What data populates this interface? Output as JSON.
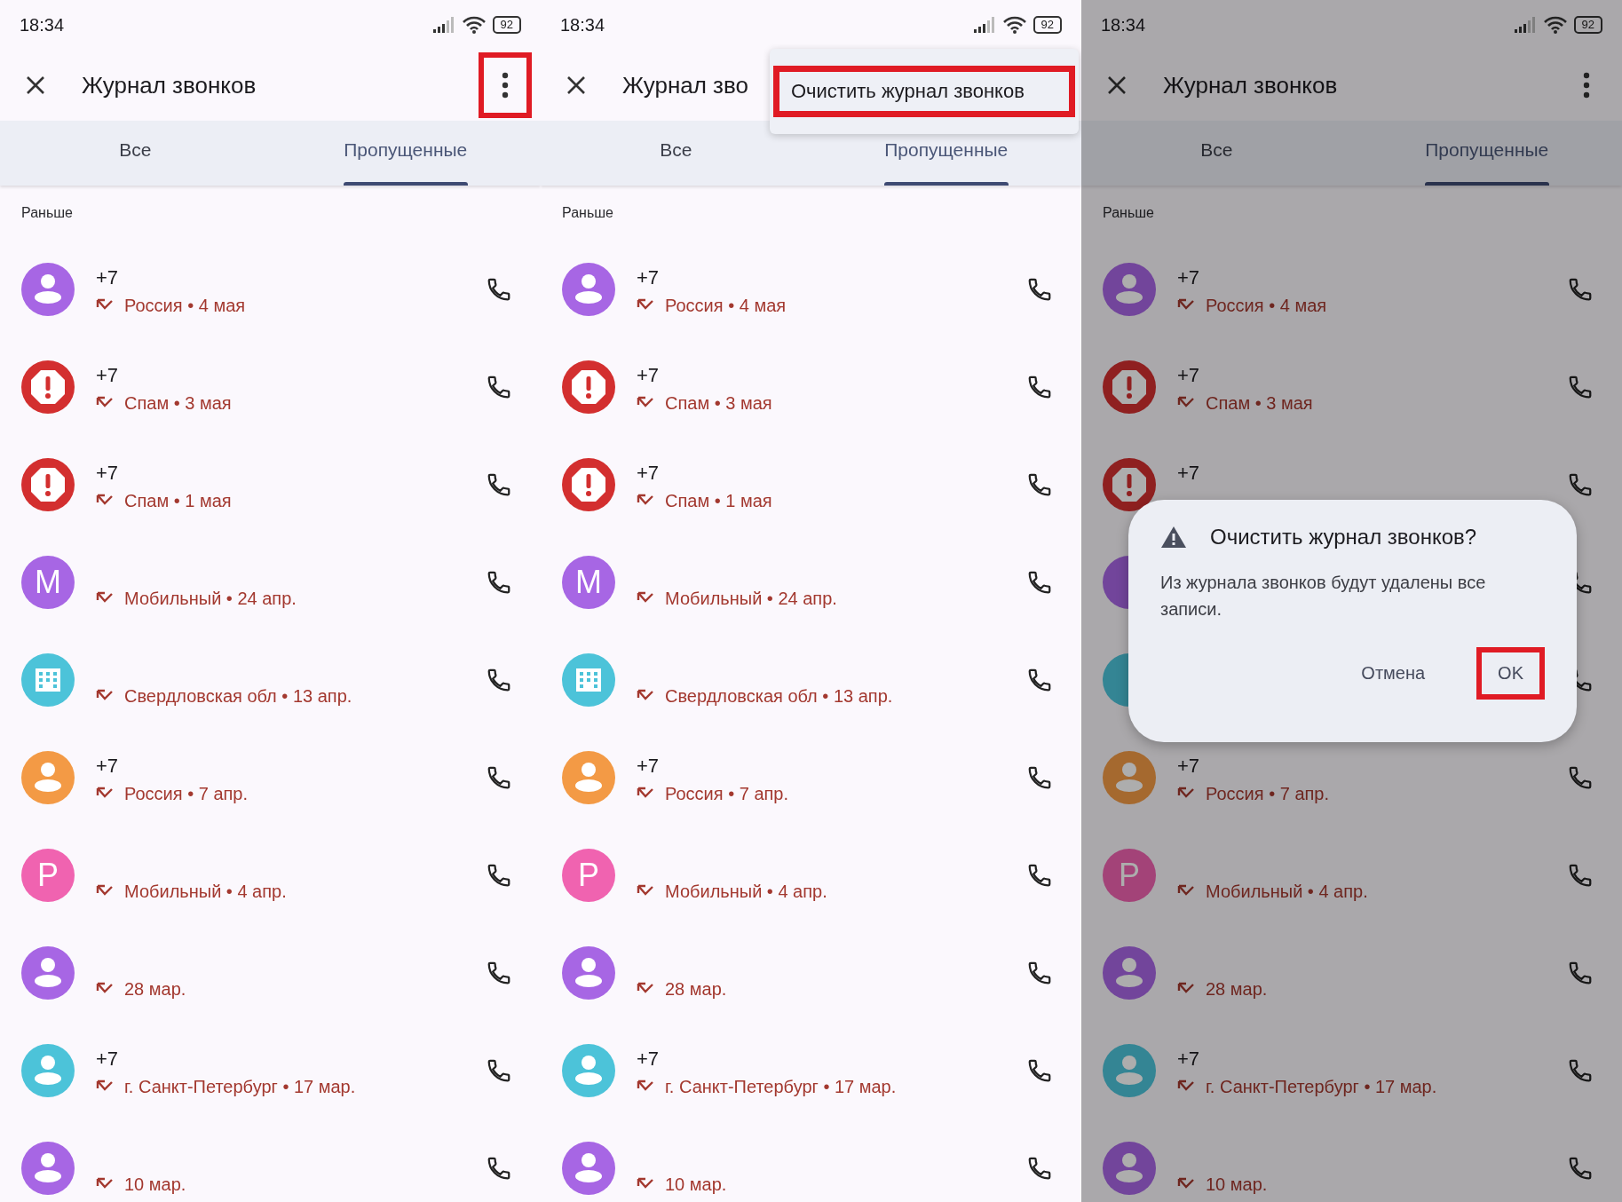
{
  "panels": [
    {
      "status_bar": {
        "time": "18:34",
        "battery": "92"
      },
      "app_bar": {
        "title": "Журнал звонков",
        "more_button": {
          "highlighted": true
        }
      },
      "tabs": [
        {
          "label": "Все",
          "selected": false
        },
        {
          "label": "Пропущенные",
          "selected": true
        }
      ],
      "section_label": "Раньше",
      "calls": [
        {
          "avatar": {
            "kind": "person",
            "color": "#a766e4"
          },
          "number": "+7",
          "detail": "Россия • 4 мая"
        },
        {
          "avatar": {
            "kind": "spam",
            "color": "#d32f2f"
          },
          "number": "+7",
          "detail": "Спам • 3 мая"
        },
        {
          "avatar": {
            "kind": "spam",
            "color": "#d32f2f"
          },
          "number": "+7",
          "detail": "Спам • 1 мая"
        },
        {
          "avatar": {
            "kind": "letter",
            "color": "#a766e4",
            "letter": "M"
          },
          "detail": "Мобильный • 24 апр."
        },
        {
          "avatar": {
            "kind": "business",
            "color": "#4cc3d9"
          },
          "detail": "Свердловская обл • 13 апр."
        },
        {
          "avatar": {
            "kind": "person",
            "color": "#f39a45"
          },
          "number": "+7",
          "detail": "Россия • 7 апр."
        },
        {
          "avatar": {
            "kind": "letter",
            "color": "#f063b0",
            "letter": "P"
          },
          "detail": "Мобильный • 4 апр."
        },
        {
          "avatar": {
            "kind": "person",
            "color": "#a766e4"
          },
          "detail": "28 мар."
        },
        {
          "avatar": {
            "kind": "person",
            "color": "#4cc3d9"
          },
          "number": "+7",
          "detail": "г. Санкт-Петербург • 17 мар."
        },
        {
          "avatar": {
            "kind": "person",
            "color": "#a766e4"
          },
          "detail": "10 мар."
        }
      ]
    },
    {
      "status_bar": {
        "time": "18:34",
        "battery": "92"
      },
      "app_bar": {
        "title": "Журнал зво"
      },
      "tabs": [
        {
          "label": "Все",
          "selected": false
        },
        {
          "label": "Пропущенные",
          "selected": true
        }
      ],
      "section_label": "Раньше",
      "menu": {
        "items": [
          {
            "label": "Очистить журнал звонков",
            "highlighted": true
          }
        ]
      },
      "calls": [
        {
          "avatar": {
            "kind": "person",
            "color": "#a766e4"
          },
          "number": "+7",
          "detail": "Россия • 4 мая"
        },
        {
          "avatar": {
            "kind": "spam",
            "color": "#d32f2f"
          },
          "number": "+7",
          "detail": "Спам • 3 мая"
        },
        {
          "avatar": {
            "kind": "spam",
            "color": "#d32f2f"
          },
          "number": "+7",
          "detail": "Спам • 1 мая"
        },
        {
          "avatar": {
            "kind": "letter",
            "color": "#a766e4",
            "letter": "M"
          },
          "detail": "Мобильный • 24 апр."
        },
        {
          "avatar": {
            "kind": "business",
            "color": "#4cc3d9"
          },
          "detail": "Свердловская обл • 13 апр."
        },
        {
          "avatar": {
            "kind": "person",
            "color": "#f39a45"
          },
          "number": "+7",
          "detail": "Россия • 7 апр."
        },
        {
          "avatar": {
            "kind": "letter",
            "color": "#f063b0",
            "letter": "P"
          },
          "detail": "Мобильный • 4 апр."
        },
        {
          "avatar": {
            "kind": "person",
            "color": "#a766e4"
          },
          "detail": "28 мар."
        },
        {
          "avatar": {
            "kind": "person",
            "color": "#4cc3d9"
          },
          "number": "+7",
          "detail": "г. Санкт-Петербург • 17 мар."
        },
        {
          "avatar": {
            "kind": "person",
            "color": "#a766e4"
          },
          "detail": "10 мар."
        }
      ]
    },
    {
      "status_bar": {
        "time": "18:34",
        "battery": "92"
      },
      "app_bar": {
        "title": "Журнал звонков",
        "more_button": {
          "highlighted": false
        }
      },
      "tabs": [
        {
          "label": "Все",
          "selected": false
        },
        {
          "label": "Пропущенные",
          "selected": true
        }
      ],
      "section_label": "Раньше",
      "dimmed": true,
      "dialog": {
        "title": "Очистить журнал звонков?",
        "message": "Из журнала звонков будут удалены все записи.",
        "buttons": [
          {
            "label": "Отмена",
            "highlighted": false
          },
          {
            "label": "OK",
            "highlighted": true
          }
        ]
      },
      "calls": [
        {
          "avatar": {
            "kind": "person",
            "color": "#72459b"
          },
          "number": "+7",
          "detail": "Россия • 4 мая"
        },
        {
          "avatar": {
            "kind": "spam",
            "color": "#8f2020"
          },
          "number": "+7",
          "detail": "Спам • 3 мая"
        },
        {
          "avatar": {
            "kind": "spam",
            "color": "#8f2020"
          },
          "number": "+7"
        },
        {
          "avatar": {
            "kind": "letter",
            "color": "#72459b"
          }
        },
        {
          "avatar": {
            "kind": "business",
            "color": "#348594",
            "icon_hidden": true
          }
        },
        {
          "avatar": {
            "kind": "person",
            "color": "#a5692f"
          },
          "number": "+7",
          "detail": "Россия • 7 апр."
        },
        {
          "avatar": {
            "kind": "letter",
            "color": "#a34378",
            "letter": "P"
          },
          "detail": "Мобильный • 4 апр."
        },
        {
          "avatar": {
            "kind": "person",
            "color": "#72459b"
          },
          "detail": "28 мар."
        },
        {
          "avatar": {
            "kind": "person",
            "color": "#348594"
          },
          "number": "+7",
          "detail": "г. Санкт-Петербург • 17 мар."
        },
        {
          "avatar": {
            "kind": "person",
            "color": "#72459b"
          },
          "detail": "10 мар."
        }
      ]
    }
  ]
}
